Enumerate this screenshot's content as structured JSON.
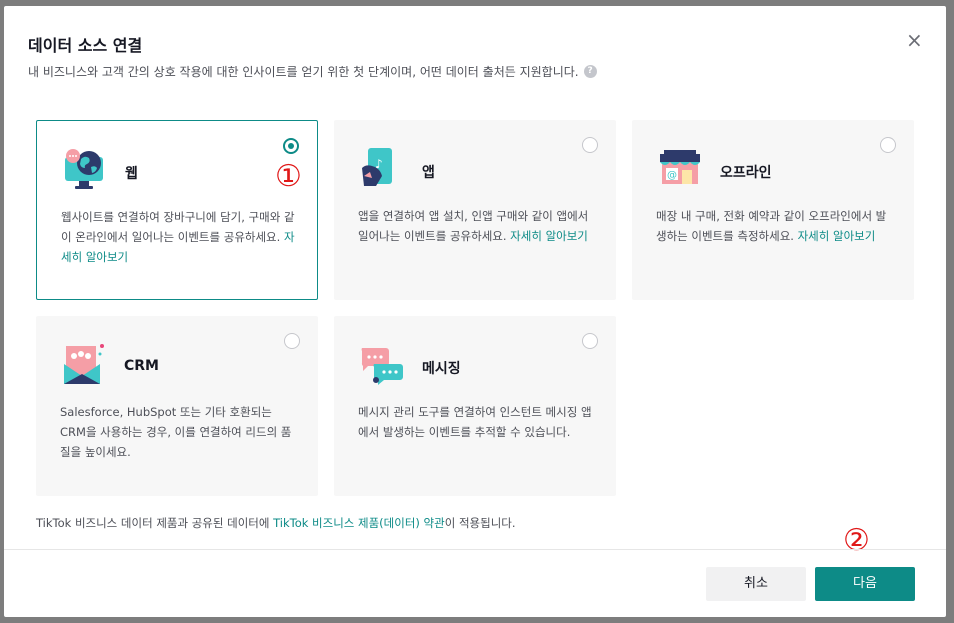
{
  "dialog": {
    "title": "데이터 소스 연결",
    "subtitle": "내 비즈니스와 고객 간의 상호 작용에 대한 인사이트를 얻기 위한 첫 단계이며, 어떤 데이터 출처든 지원합니다.",
    "help_icon": "question-icon",
    "close_icon": "×"
  },
  "cards": [
    {
      "key": "web",
      "title": "웹",
      "desc": "웹사이트를 연결하여 장바구니에 담기, 구매와 같이 온라인에서 일어나는 이벤트를 공유하세요. ",
      "link": "자세히 알아보기",
      "selected": true,
      "icon": "globe-monitor-icon"
    },
    {
      "key": "app",
      "title": "앱",
      "desc": "앱을 연결하여 앱 설치, 인앱 구매와 같이 앱에서 일어나는 이벤트를 공유하세요. ",
      "link": "자세히 알아보기",
      "selected": false,
      "icon": "phone-app-icon"
    },
    {
      "key": "offline",
      "title": "오프라인",
      "desc": "매장 내 구매, 전화 예약과 같이 오프라인에서 발생하는 이벤트를 측정하세요. ",
      "link": "자세히 알아보기",
      "selected": false,
      "icon": "storefront-icon"
    },
    {
      "key": "crm",
      "title": "CRM",
      "desc": "Salesforce, HubSpot 또는 기타 호환되는 CRM을 사용하는 경우, 이를 연결하여 리드의 품질을 높이세요.",
      "link": "",
      "selected": false,
      "icon": "crm-envelope-icon"
    },
    {
      "key": "messaging",
      "title": "메시징",
      "desc": "메시지 관리 도구를 연결하여 인스턴트 메시징 앱에서 발생하는 이벤트를 추적할 수 있습니다.",
      "link": "",
      "selected": false,
      "icon": "chat-bubbles-icon"
    }
  ],
  "terms": {
    "prefix": "TikTok 비즈니스 데이터 제품과 공유된 데이터에 ",
    "link": "TikTok 비즈니스 제품(데이터) 약관",
    "suffix": "이 적용됩니다."
  },
  "buttons": {
    "cancel": "취소",
    "next": "다음"
  },
  "annotations": {
    "one": "①",
    "two": "②"
  },
  "colors": {
    "accent": "#0d8b87",
    "annotation": "#e01818"
  }
}
